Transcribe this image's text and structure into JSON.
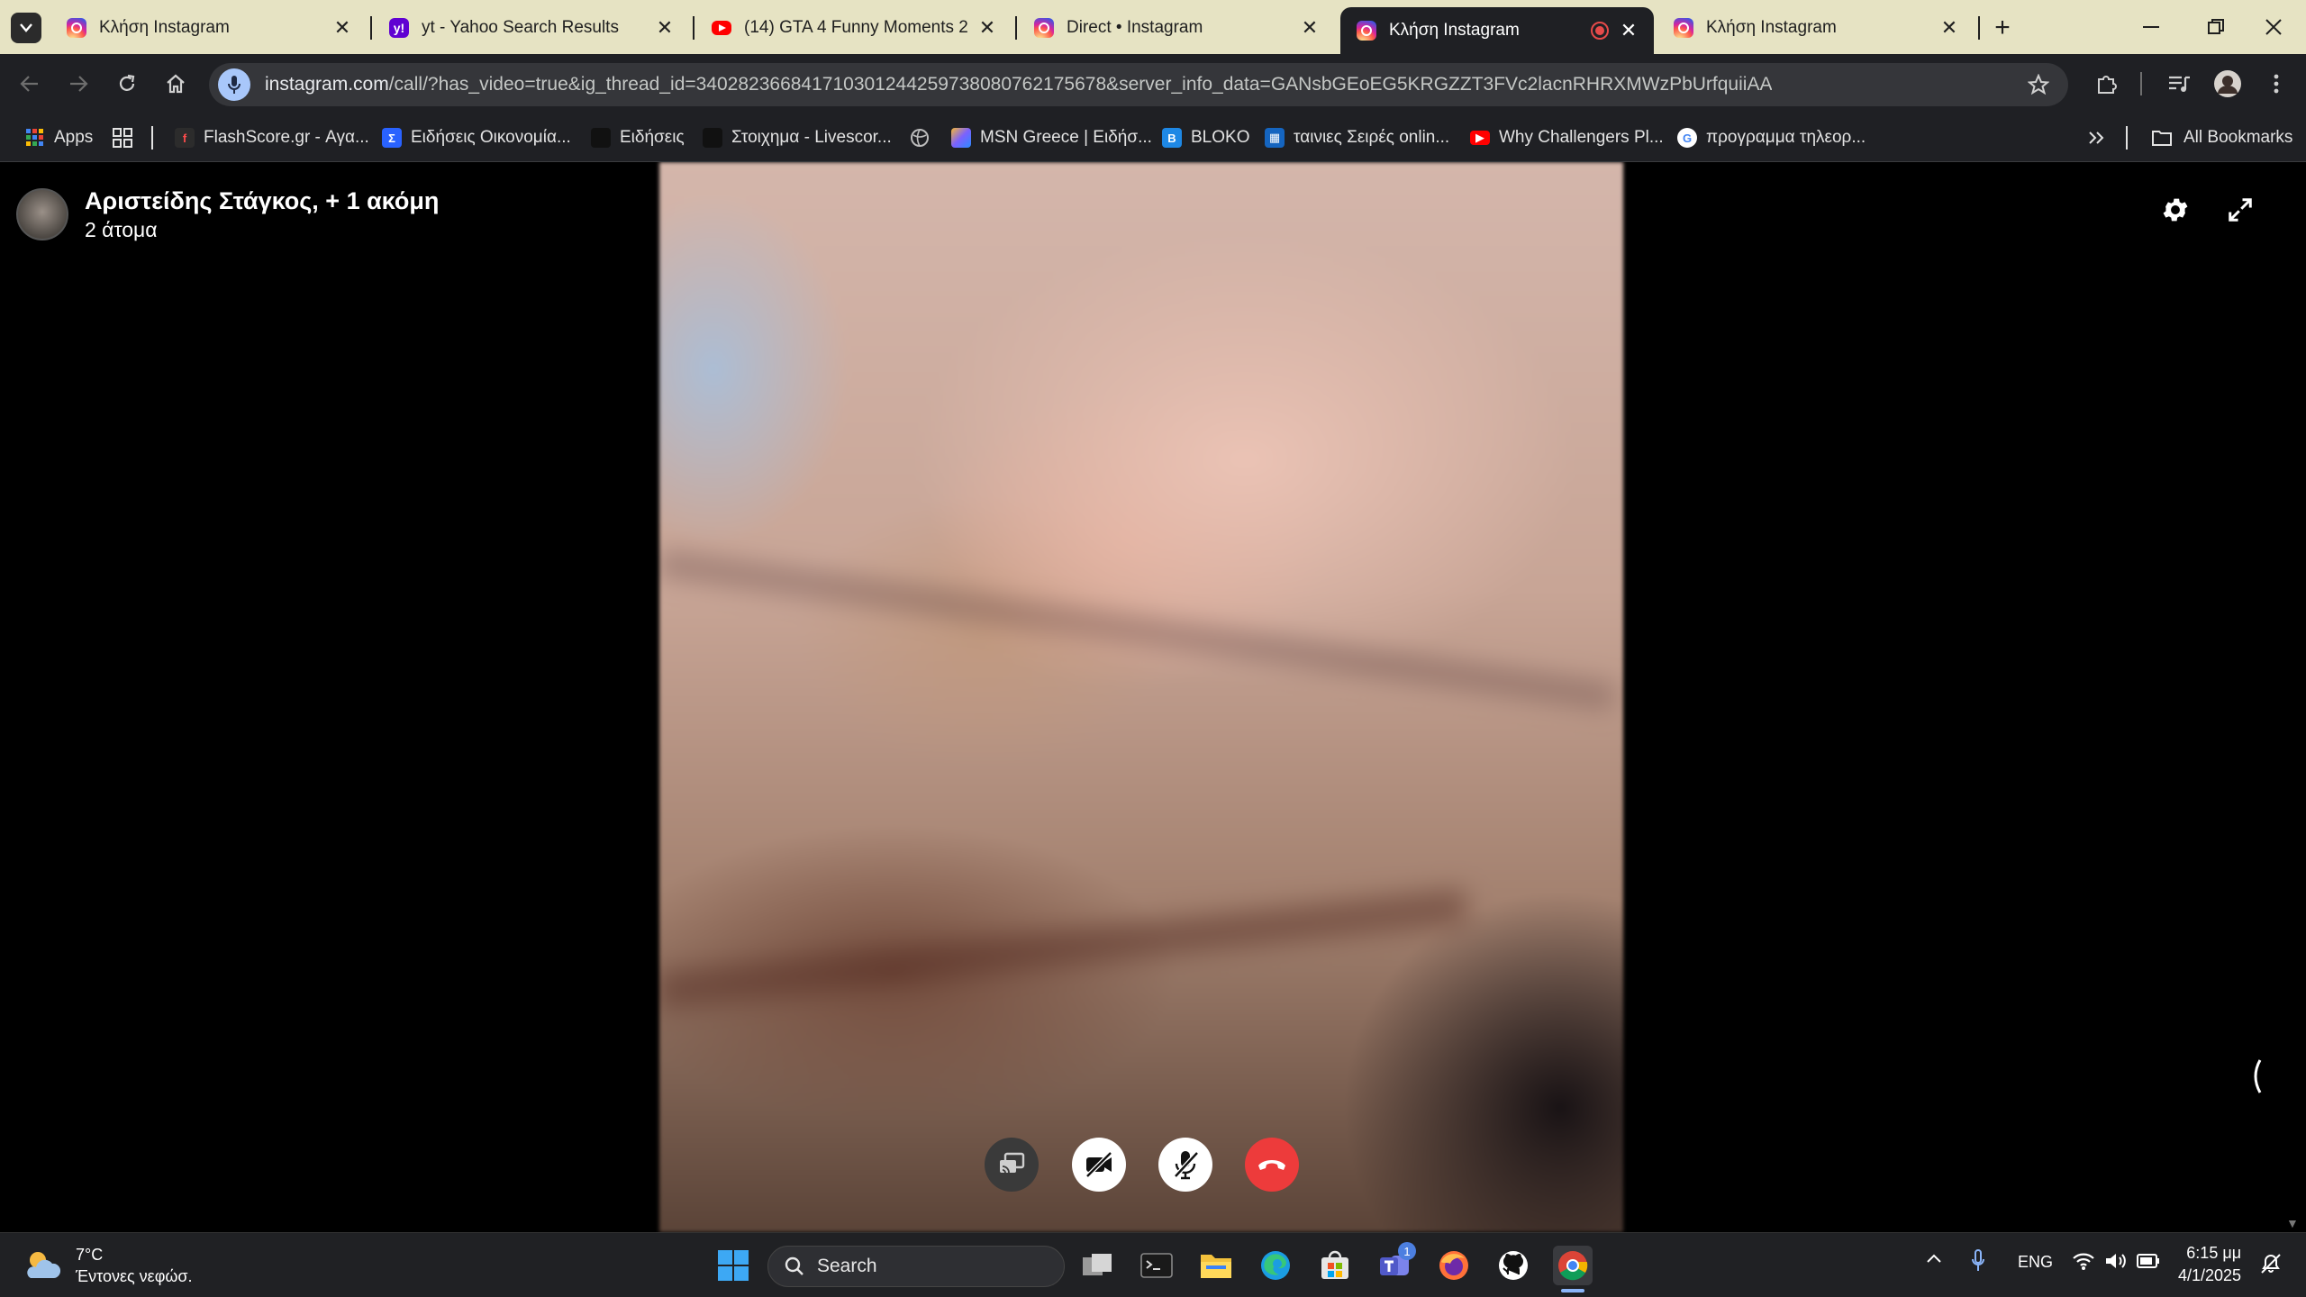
{
  "browser": {
    "tabs": [
      {
        "title": "Κλήση Instagram",
        "favicon": "instagram-icon",
        "active": false
      },
      {
        "title": "yt - Yahoo Search Results",
        "favicon": "yahoo-icon",
        "active": false
      },
      {
        "title": "(14) GTA 4 Funny Moments 2 -",
        "favicon": "youtube-icon",
        "active": false
      },
      {
        "title": "Direct • Instagram",
        "favicon": "instagram-icon",
        "active": false
      },
      {
        "title": "Κλήση Instagram",
        "favicon": "instagram-icon",
        "active": true,
        "recording": true
      },
      {
        "title": "Κλήση Instagram",
        "favicon": "instagram-icon",
        "active": false
      }
    ],
    "new_tab_label": "+",
    "address": {
      "host": "instagram.com",
      "path": "/call/?has_video=true&ig_thread_id=340282366841710301244259738080762175678&server_info_data=GANsbGEoEG5KRGZZT3FVc2lacnRHRXMWzPbUrfquiiAA"
    },
    "bookmarks": [
      {
        "label": "Apps",
        "icon": "apps-grid-icon",
        "color": "#4285f4"
      },
      {
        "label": "FlashScore.gr - Αγα...",
        "icon": "flashscore-icon",
        "color": "#2c2c2c"
      },
      {
        "label": "Ειδήσεις Οικονομία...",
        "icon": "sigma-icon",
        "color": "#2962ff"
      },
      {
        "label": "Ειδήσεις",
        "icon": "bookmark-black-icon",
        "color": "#111111"
      },
      {
        "label": "Στοιχημα - Livescor...",
        "icon": "bookmark-black-icon",
        "color": "#111111"
      },
      {
        "label": "MSN Greece | Ειδήσ...",
        "icon": "msn-icon",
        "color": "#7b61ff"
      },
      {
        "label": "BLOKO",
        "icon": "bloko-icon",
        "color": "#1e88e5"
      },
      {
        "label": "ταινιες Σειρές onlin...",
        "icon": "clapperboard-icon",
        "color": "#1565c0"
      },
      {
        "label": "Why Challengers Pl...",
        "icon": "youtube-icon",
        "color": "#ff0000"
      },
      {
        "label": "προγραμμα τηλεορ...",
        "icon": "google-icon",
        "color": "#ffffff"
      }
    ],
    "all_bookmarks_label": "All Bookmarks"
  },
  "call": {
    "caller_name": "Αριστείδης Στάγκος, + 1 ακόμη",
    "participants_text": "2 άτομα",
    "controls": [
      {
        "name": "share-screen-button",
        "icon": "cast-icon",
        "color": "#3a3a3a"
      },
      {
        "name": "video-off-button",
        "icon": "video-off-icon",
        "color": "#ffffff"
      },
      {
        "name": "mic-off-button",
        "icon": "mic-off-icon",
        "color": "#ffffff"
      },
      {
        "name": "end-call-button",
        "icon": "phone-hangup-icon",
        "color": "#ed3b3b"
      }
    ]
  },
  "taskbar": {
    "weather": {
      "temp": "7°C",
      "condition": "Έντονες νεφώσ."
    },
    "search_placeholder": "Search",
    "language": "ENG",
    "time": "6:15 μμ",
    "date": "4/1/2025",
    "teams_badge": "1"
  }
}
